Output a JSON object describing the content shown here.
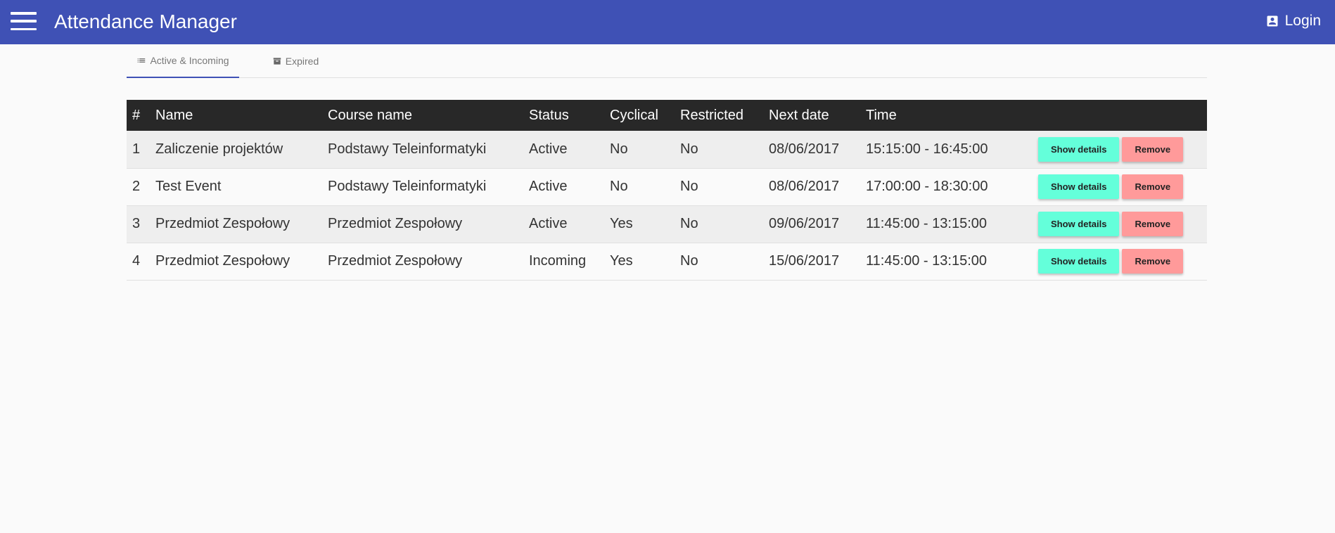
{
  "app": {
    "title": "Attendance Manager",
    "login_label": "Login"
  },
  "colors": {
    "appbar": "#3f51b5",
    "details_button": "#64ffda",
    "remove_button": "#ff9a9a",
    "table_header": "#282828"
  },
  "icons": {
    "menu": "hamburger-icon",
    "login": "account-box-icon",
    "tab_active": "list-icon",
    "tab_expired": "archive-icon"
  },
  "tabs": [
    {
      "label": "Active & Incoming",
      "active": true
    },
    {
      "label": "Expired",
      "active": false
    }
  ],
  "table": {
    "headers": [
      "#",
      "Name",
      "Course name",
      "Status",
      "Cyclical",
      "Restricted",
      "Next date",
      "Time",
      ""
    ],
    "rows": [
      {
        "num": "1",
        "name": "Zaliczenie projektów",
        "course": "Podstawy Teleinformatyki",
        "status": "Active",
        "cyclical": "No",
        "restricted": "No",
        "next_date": "08/06/2017",
        "time": "15:15:00 - 16:45:00"
      },
      {
        "num": "2",
        "name": "Test Event",
        "course": "Podstawy Teleinformatyki",
        "status": "Active",
        "cyclical": "No",
        "restricted": "No",
        "next_date": "08/06/2017",
        "time": "17:00:00 - 18:30:00"
      },
      {
        "num": "3",
        "name": "Przedmiot Zespołowy",
        "course": "Przedmiot Zespołowy",
        "status": "Active",
        "cyclical": "Yes",
        "restricted": "No",
        "next_date": "09/06/2017",
        "time": "11:45:00 - 13:15:00"
      },
      {
        "num": "4",
        "name": "Przedmiot Zespołowy",
        "course": "Przedmiot Zespołowy",
        "status": "Incoming",
        "cyclical": "Yes",
        "restricted": "No",
        "next_date": "15/06/2017",
        "time": "11:45:00 - 13:15:00"
      }
    ],
    "show_details_label": "Show details",
    "remove_label": "Remove"
  }
}
